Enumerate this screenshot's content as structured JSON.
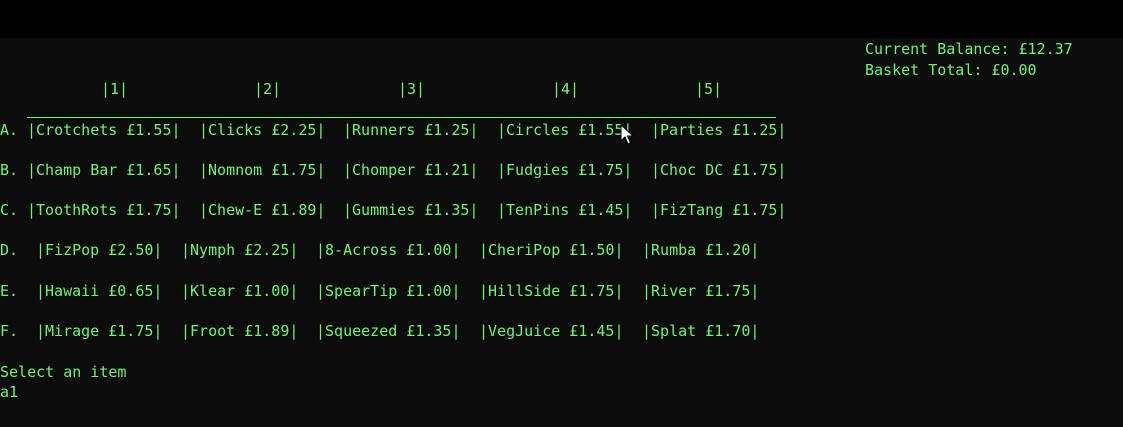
{
  "colors": {
    "text": "#6ff56f",
    "background": "#0c0c0c",
    "topbar": "#000000"
  },
  "status": {
    "balance": "Current Balance: £12.37",
    "basket": "Basket Total: £0.00"
  },
  "columns": [
    "|1|",
    "|2|",
    "|3|",
    "|4|",
    "|5|"
  ],
  "rows": [
    {
      "label": "A.",
      "items": [
        "|Crotchets £1.55|",
        "|Clicks £2.25|",
        "|Runners £1.25|",
        "|Circles £1.55|",
        "|Parties £1.25|"
      ]
    },
    {
      "label": "B.",
      "items": [
        "|Champ Bar £1.65|",
        "|Nomnom £1.75|",
        "|Chomper £1.21|",
        "|Fudgies £1.75|",
        "|Choc DC £1.75|"
      ]
    },
    {
      "label": "C.",
      "items": [
        "|ToothRots £1.75|",
        "|Chew-E £1.89|",
        "|Gummies £1.35|",
        "|TenPins £1.45|",
        "|FizTang £1.75|"
      ]
    },
    {
      "label": "D.",
      "items": [
        "|FizPop £2.50|",
        "|Nymph £2.25|",
        "|8-Across £1.00|",
        "|CheriPop £1.50|",
        "|Rumba £1.20|"
      ]
    },
    {
      "label": "E.",
      "items": [
        "|Hawaii £0.65|",
        "|Klear £1.00|",
        "|SpearTip £1.00|",
        "|HillSide £1.75|",
        "|River £1.75|"
      ]
    },
    {
      "label": "F.",
      "items": [
        "|Mirage £1.75|",
        "|Froot £1.89|",
        "|Squeezed £1.35|",
        "|VegJuice £1.45|",
        "|Splat £1.70|"
      ]
    }
  ],
  "prompt": "Select an item",
  "input_value": "a1",
  "icons": {
    "cursor": "mouse-pointer-icon"
  }
}
